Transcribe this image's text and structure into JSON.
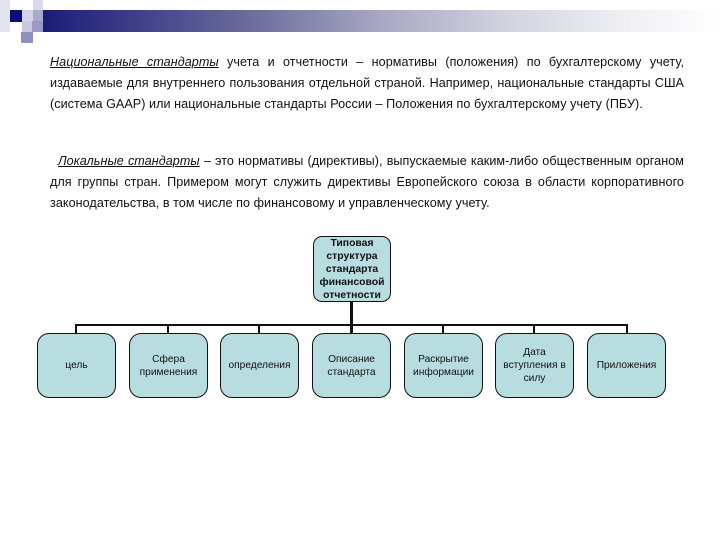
{
  "slide": {
    "colors": {
      "title_bar_start": "#1c1c78",
      "title_bar_end": "#ffffff",
      "node_fill": "#b8dde0",
      "node_border": "#111111",
      "text": "#111111"
    },
    "paragraphs": [
      {
        "term": "Национальные стандарты",
        "text": " учета и отчетности – нормативы (положения) по бухгалтерскому учету, издаваемые для внутреннего пользования отдельной страной. Например, национальные стандарты США (система GAAP) или национальные стандарты России – Положения по бухгалтерскому учету (ПБУ)."
      },
      {
        "term": "Локальные стандарты",
        "text": " – это нормативы (директивы), выпускаемые каким-либо общественным органом для группы стран. Примером могут служить директивы Европейского союза в области корпоративного законодательства, в том числе по финансовому и управленческому учету."
      }
    ],
    "diagram": {
      "root": "Типовая структура стандарта финансовой отчетности",
      "children": [
        "цель",
        "Сфера применения",
        "определения",
        "Описание стандарта",
        "Раскрытие информации",
        "Дата вступления в силу",
        "Приложения"
      ]
    }
  }
}
